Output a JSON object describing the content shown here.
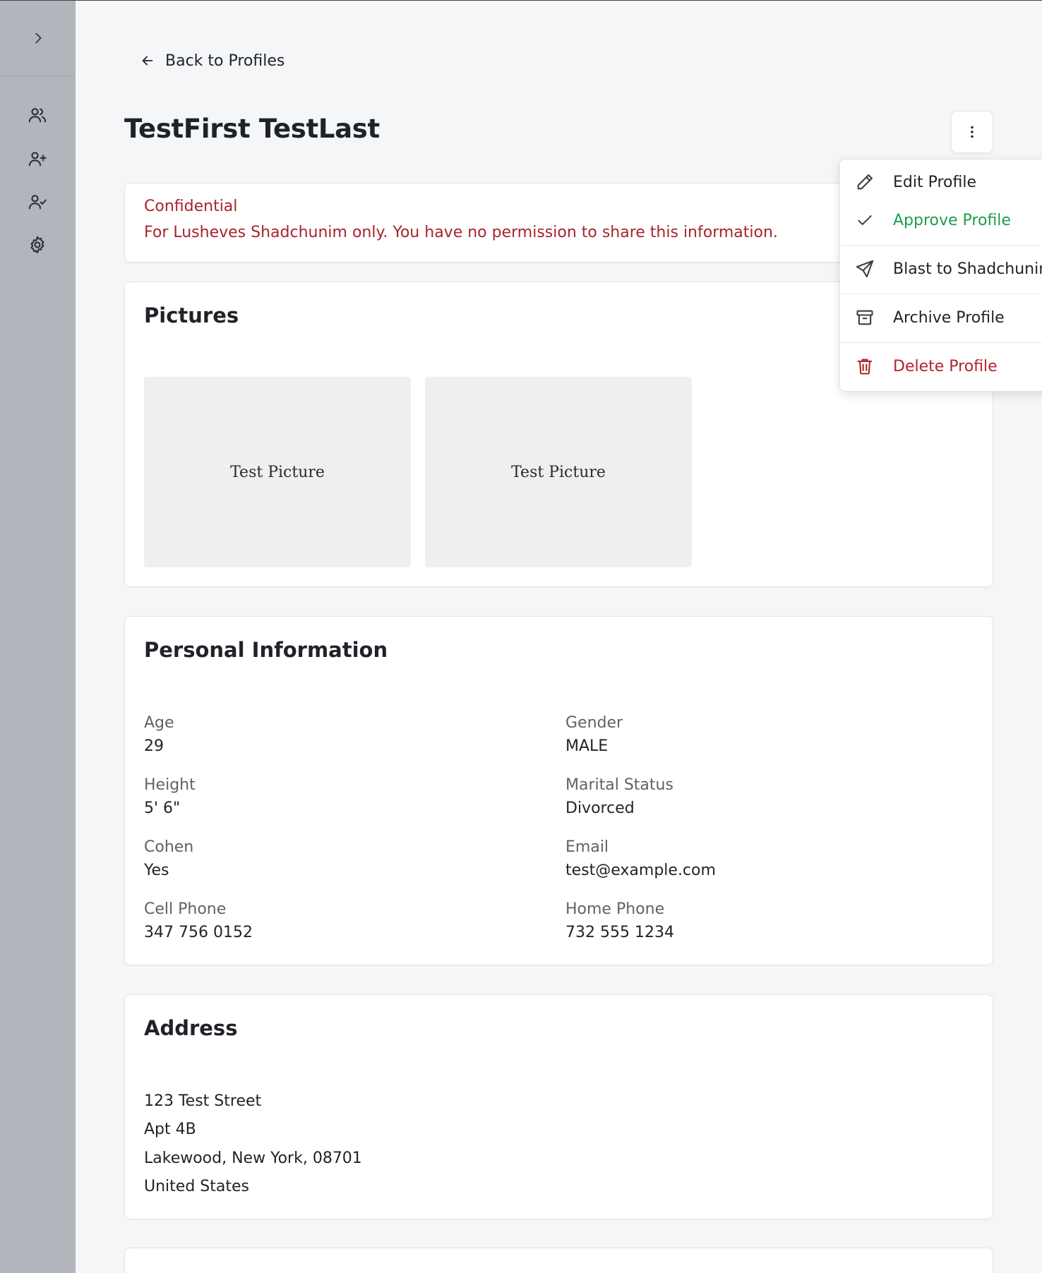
{
  "back_label": "Back to Profiles",
  "profile_name": "TestFirst TestLast",
  "confidential": {
    "title": "Confidential",
    "text": "For Lusheves Shadchunim only. You have no permission to share this information."
  },
  "pictures": {
    "title": "Pictures",
    "items": [
      "Test Picture",
      "Test Picture"
    ]
  },
  "personal": {
    "title": "Personal Information",
    "fields": [
      {
        "label": "Age",
        "value": "29"
      },
      {
        "label": "Gender",
        "value": "MALE"
      },
      {
        "label": "Height",
        "value": "5' 6\""
      },
      {
        "label": "Marital Status",
        "value": "Divorced"
      },
      {
        "label": "Cohen",
        "value": "Yes"
      },
      {
        "label": "Email",
        "value": "test@example.com"
      },
      {
        "label": "Cell Phone",
        "value": "347 756 0152"
      },
      {
        "label": "Home Phone",
        "value": "732 555 1234"
      }
    ]
  },
  "address": {
    "title": "Address",
    "lines": [
      "123 Test Street",
      "Apt 4B",
      "Lakewood, New York, 08701",
      "United States"
    ]
  },
  "menu": {
    "items": [
      {
        "label": "Edit Profile",
        "icon": "pencil-icon",
        "color": "#1f2328"
      },
      {
        "label": "Approve Profile",
        "icon": "check-icon",
        "color": "#1f9d48"
      },
      {
        "label": "Blast to Shadchunim",
        "icon": "send-icon",
        "color": "#1f2328"
      },
      {
        "label": "Archive Profile",
        "icon": "archive-icon",
        "color": "#1f2328"
      },
      {
        "label": "Delete Profile",
        "icon": "trash-icon",
        "color": "#b4232c"
      }
    ]
  },
  "sidebar": {
    "items": [
      {
        "icon": "users-icon"
      },
      {
        "icon": "user-plus-icon"
      },
      {
        "icon": "user-check-icon"
      },
      {
        "icon": "gear-icon"
      }
    ]
  }
}
